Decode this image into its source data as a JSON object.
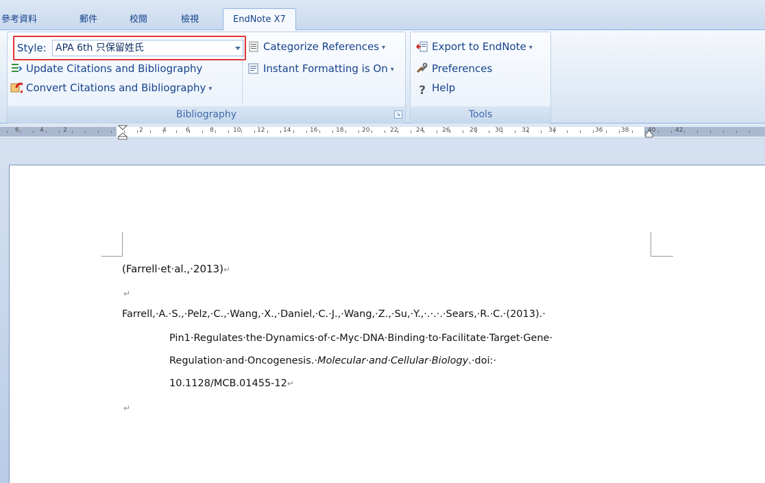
{
  "tabs": [
    {
      "label": "參考資料"
    },
    {
      "label": "郵件"
    },
    {
      "label": "校閱"
    },
    {
      "label": "檢視"
    },
    {
      "label": "EndNote X7"
    }
  ],
  "ribbon": {
    "bibliography": {
      "style_label": "Style:",
      "style_value": "APA 6th 只保留姓氏",
      "update_label": "Update Citations and Bibliography",
      "convert_label": "Convert Citations and Bibliography",
      "categorize_label": "Categorize References",
      "instant_label": "Instant Formatting is On",
      "group_label": "Bibliography"
    },
    "tools": {
      "export_label": "Export to EndNote",
      "preferences_label": "Preferences",
      "help_label": "Help",
      "group_label": "Tools"
    }
  },
  "ruler": {
    "labels": [
      "6",
      "4",
      "2",
      "2",
      "4",
      "6",
      "8",
      "10",
      "12",
      "14",
      "16",
      "18",
      "20",
      "22",
      "24",
      "26",
      "28",
      "30",
      "32",
      "34",
      "36",
      "38",
      "40",
      "42"
    ]
  },
  "document": {
    "citation": "(Farrell·et·al.,·2013)",
    "ref_line1": "Farrell,·A.·S.,·Pelz,·C.,·Wang,·X.,·Daniel,·C.·J.,·Wang,·Z.,·Su,·Y.,·.·.·.·Sears,·R.·C.·(2013).·",
    "ref_line2": "Pin1·Regulates·the·Dynamics·of·c-Myc·DNA·Binding·to·Facilitate·Target·Gene·",
    "ref_line3_a": "Regulation·and·Oncogenesis.·",
    "ref_line3_journal": "Molecular·and·Cellular·Biology",
    "ref_line3_b": ".·doi:·",
    "ref_line4": "10.1128/MCB.01455-12",
    "para_mark": "↵"
  }
}
